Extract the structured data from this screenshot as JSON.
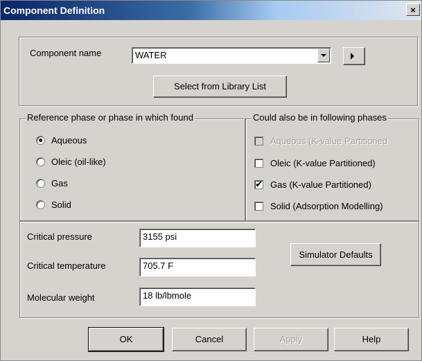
{
  "window": {
    "title": "Component Definition",
    "close_glyph": "×"
  },
  "component": {
    "name_label": "Component name",
    "name_value": "WATER",
    "library_button": "Select from Library List"
  },
  "reference_phase": {
    "legend": "Reference phase or phase in which found",
    "selected": "Aqueous",
    "options": [
      "Aqueous",
      "Oleic (oil-like)",
      "Gas",
      "Solid"
    ]
  },
  "other_phases": {
    "legend": "Could also be in following phases",
    "options": [
      {
        "label": "Aqueous (K-value Partitioned",
        "checked": false,
        "disabled": true
      },
      {
        "label": "Oleic (K-value Partitioned)",
        "checked": false,
        "disabled": false
      },
      {
        "label": "Gas (K-value Partitioned)",
        "checked": true,
        "disabled": false
      },
      {
        "label": "Solid (Adsorption Modelling)",
        "checked": false,
        "disabled": false
      }
    ]
  },
  "properties": {
    "critical_pressure_label": "Critical pressure",
    "critical_pressure_value": "3155 psi",
    "critical_temperature_label": "Critical temperature",
    "critical_temperature_value": "705.7 F",
    "molecular_weight_label": "Molecular weight",
    "molecular_weight_value": "18 lb/lbmole",
    "defaults_button": "Simulator Defaults"
  },
  "footer": {
    "ok": "OK",
    "cancel": "Cancel",
    "apply": "Apply",
    "help": "Help"
  },
  "icons": {
    "close": "close-icon",
    "dropdown": "chevron-down-icon",
    "expand": "play-right-icon",
    "check": "✔"
  }
}
